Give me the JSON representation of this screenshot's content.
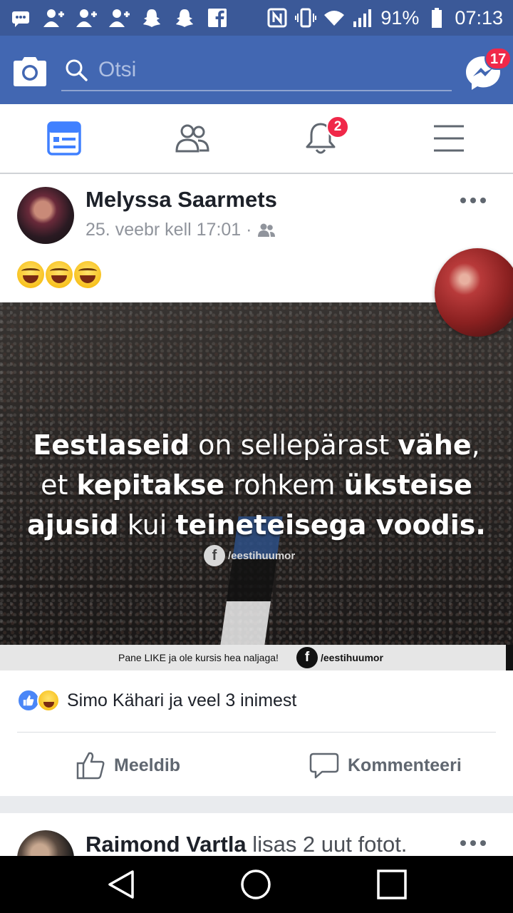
{
  "status_bar": {
    "battery": "91%",
    "time": "07:13",
    "icons": [
      "message-icon",
      "add-user-icon",
      "add-user-icon",
      "add-user-icon",
      "snapchat-icon",
      "snapchat-icon",
      "facebook-icon",
      "nfc-icon",
      "vibrate-icon",
      "wifi-icon",
      "signal-icon",
      "battery-icon"
    ]
  },
  "header": {
    "search_placeholder": "Otsi",
    "messenger_badge": "17"
  },
  "nav_tabs": {
    "notifications_badge": "2"
  },
  "post": {
    "author": "Melyssa Saarmets",
    "timestamp": "25. veebr kell 17:01 ·",
    "audience_icon": "friends-icon",
    "emoji_text": "😂😂😂",
    "image": {
      "text_lines": [
        {
          "bold1": "Eestlaseid",
          "normal1": " on sellepärast ",
          "bold2": "vähe",
          "normal2": ","
        },
        {
          "normal1": "et ",
          "bold1": "kepitakse",
          "normal2": " rohkem ",
          "bold2": "üksteise"
        },
        {
          "bold1": "ajusid",
          "normal1": " kui ",
          "bold2": "teineteisega voodis."
        }
      ],
      "watermark": "/eestihuumor",
      "strip_text": "Pane LIKE ja ole kursis hea naljaga!",
      "strip_handle": "/eestihuumor"
    },
    "reactions_text": "Simo Kähari ja veel 3 inimest",
    "like_label": "Meeldib",
    "comment_label": "Kommenteeri"
  },
  "next_post": {
    "author": "Raimond Vartla",
    "action": " lisas 2 uut fotot."
  },
  "colors": {
    "status_bar": "#3b5998",
    "top_bar": "#4267b2",
    "active_tab": "#4080ff",
    "badge": "#f02849"
  }
}
